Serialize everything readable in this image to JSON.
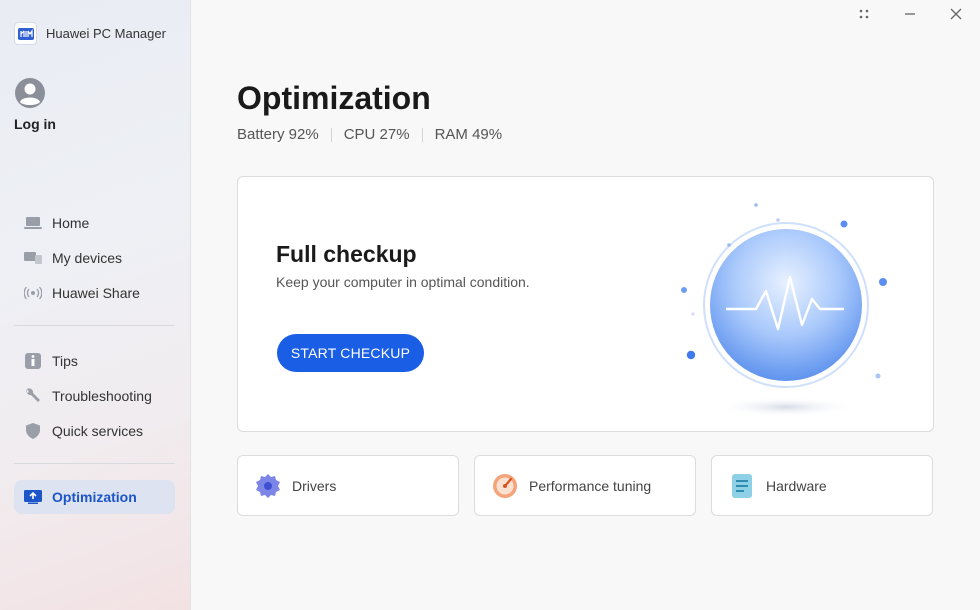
{
  "app": {
    "name": "Huawei PC Manager"
  },
  "user": {
    "login_label": "Log in"
  },
  "sidebar": {
    "group1": [
      {
        "label": "Home",
        "icon": "laptop-icon"
      },
      {
        "label": "My devices",
        "icon": "devices-icon"
      },
      {
        "label": "Huawei Share",
        "icon": "share-wireless-icon"
      }
    ],
    "group2": [
      {
        "label": "Tips",
        "icon": "tips-icon"
      },
      {
        "label": "Troubleshooting",
        "icon": "wrench-icon"
      },
      {
        "label": "Quick services",
        "icon": "shield-icon"
      }
    ],
    "active": {
      "label": "Optimization",
      "icon": "optimization-icon"
    }
  },
  "main": {
    "title": "Optimization",
    "stats": [
      {
        "text": "Battery 92%"
      },
      {
        "text": "CPU 27%"
      },
      {
        "text": "RAM 49%"
      }
    ],
    "checkup": {
      "title": "Full checkup",
      "subtitle": "Keep your computer in optimal condition.",
      "button": "START CHECKUP"
    },
    "tiles": [
      {
        "label": "Drivers",
        "icon": "gear-icon"
      },
      {
        "label": "Performance tuning",
        "icon": "speedometer-icon"
      },
      {
        "label": "Hardware",
        "icon": "document-icon"
      }
    ]
  },
  "colors": {
    "accent": "#1a5ee6",
    "active_bg": "#dde3f1",
    "active_text": "#1c55c8"
  }
}
